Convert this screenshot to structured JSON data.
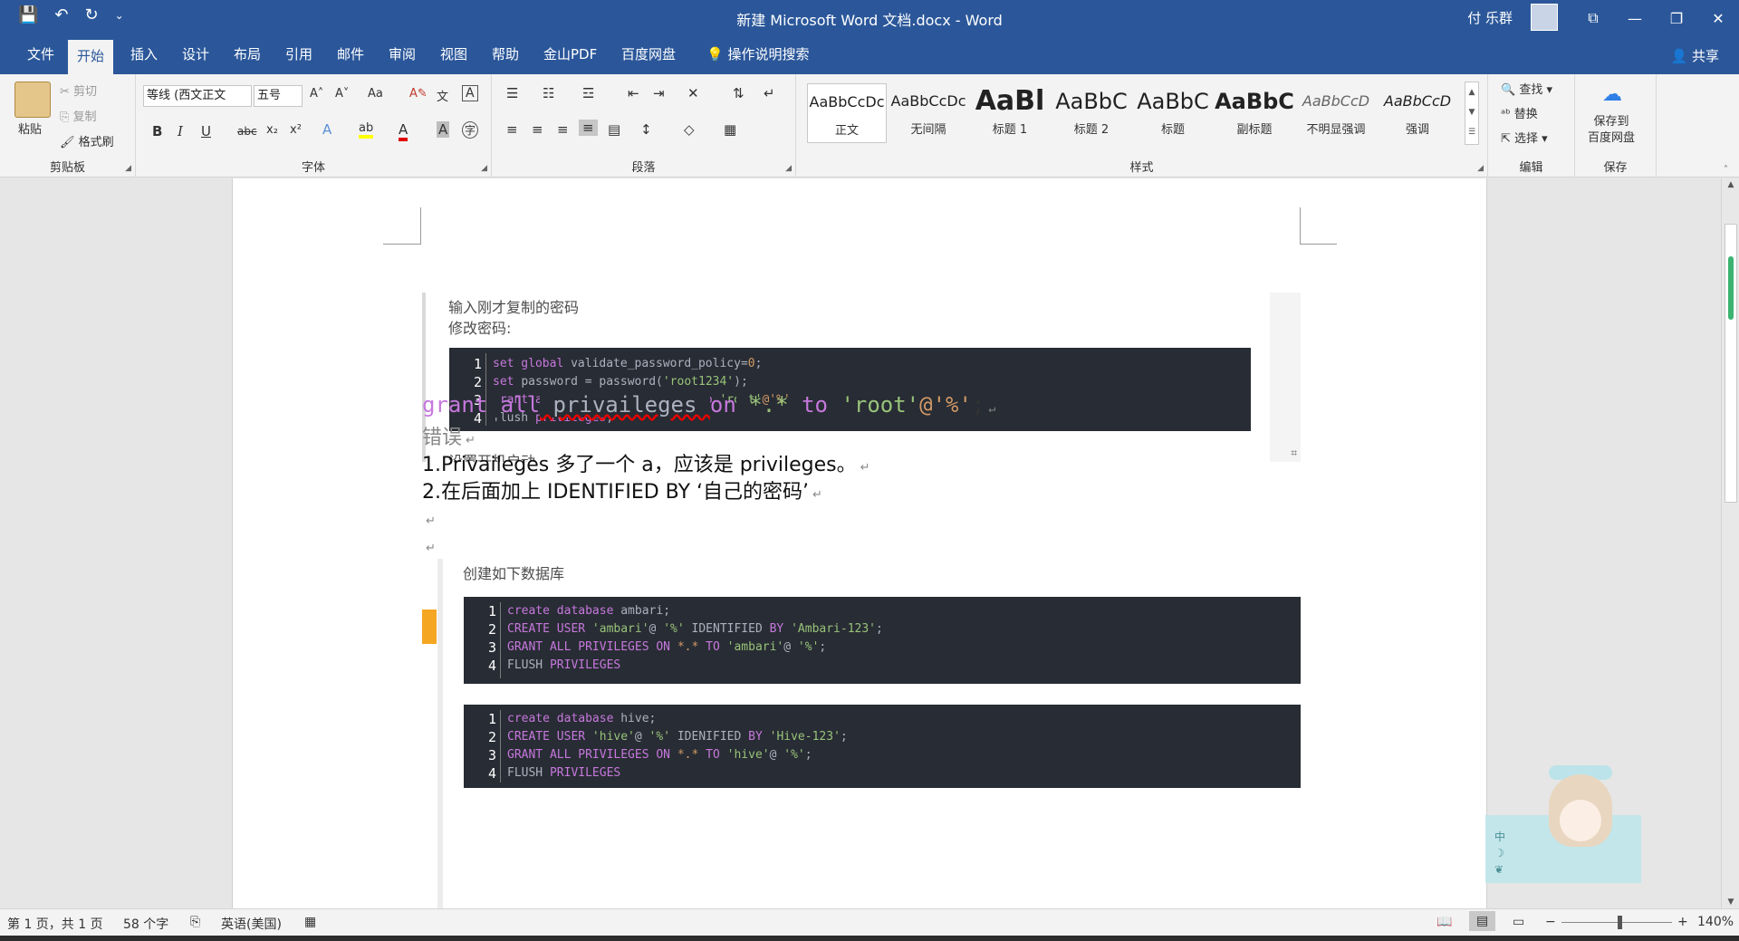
{
  "window": {
    "title": "新建 Microsoft Word 文档.docx  -  Word",
    "user": "付 乐群",
    "qat": {
      "save": "💾",
      "undo": "↶",
      "redo": "↻",
      "customize": "⌄"
    },
    "buttons": {
      "ribbon_display": "⧉",
      "minimize": "—",
      "restore": "❐",
      "close": "✕"
    }
  },
  "tabs": [
    "文件",
    "开始",
    "插入",
    "设计",
    "布局",
    "引用",
    "邮件",
    "审阅",
    "视图",
    "帮助",
    "金山PDF",
    "百度网盘"
  ],
  "tell_me": "操作说明搜索",
  "share": "共享",
  "ribbon": {
    "clipboard": {
      "label": "剪贴板",
      "paste": "粘贴",
      "cut": "剪切",
      "copy": "复制",
      "format_painter": "格式刷"
    },
    "font": {
      "label": "字体",
      "font_name": "等线 (西文正文",
      "font_size": "五号",
      "grow": "A˄",
      "shrink": "A˅",
      "case": "Aa",
      "clear": "A✎",
      "phonetic": "文",
      "border": "A",
      "bold": "B",
      "italic": "I",
      "underline": "U",
      "strike": "abc",
      "subscript": "x₂",
      "superscript": "x²",
      "effects": "A",
      "highlight": "ab",
      "color": "A",
      "shading": "A",
      "enclose": "字"
    },
    "paragraph": {
      "label": "段落"
    },
    "styles": {
      "label": "样式",
      "items": [
        {
          "sample": "AaBbCcDc",
          "name": "正文"
        },
        {
          "sample": "AaBbCcDc",
          "name": "无间隔"
        },
        {
          "sample": "AaBl",
          "name": "标题 1"
        },
        {
          "sample": "AaBbC",
          "name": "标题 2"
        },
        {
          "sample": "AaBbC",
          "name": "标题"
        },
        {
          "sample": "AaBbC",
          "name": "副标题"
        },
        {
          "sample": "AaBbCcD",
          "name": "不明显强调"
        },
        {
          "sample": "AaBbCcD",
          "name": "强调"
        }
      ]
    },
    "editing": {
      "label": "编辑",
      "find": "查找",
      "replace": "替换",
      "select": "选择"
    },
    "save": {
      "label": "保存",
      "button": "保存到\n百度网盘"
    }
  },
  "document": {
    "pasted1": {
      "line1": "输入刚才复制的密码",
      "line2": "修改密码:",
      "line3": "设置开机启动",
      "code": [
        [
          [
            "kw",
            "set global "
          ],
          [
            "t",
            "validate_password_policy"
          ],
          [
            "t",
            "="
          ],
          [
            "num",
            "0"
          ],
          [
            "t",
            ";"
          ]
        ],
        [
          [
            "kw",
            "set "
          ],
          [
            "t",
            "password = password("
          ],
          [
            "str",
            "'root1234'"
          ],
          [
            "t",
            ");"
          ]
        ],
        [
          [
            "kw",
            "grant all "
          ],
          [
            "t",
            "privaileges "
          ],
          [
            "kw",
            "on "
          ],
          [
            "num",
            "*.* "
          ],
          [
            "kw",
            "to "
          ],
          [
            "str",
            "'root'"
          ],
          [
            "num",
            "@'%'"
          ],
          [
            "t",
            ";"
          ]
        ],
        [
          [
            "t",
            "flush "
          ],
          [
            "kw",
            "privileges"
          ],
          [
            "t",
            ";"
          ]
        ]
      ]
    },
    "grant_line": {
      "grant": "grant",
      "all": "all",
      "privaileges": " privaileges ",
      "on": "on",
      "wild": "*.*",
      "to": "to",
      "root": "'root'",
      "at": "@'%'",
      "semi": ";"
    },
    "error_heading": "错误",
    "error_1": "1.Privaileges 多了一个 a，应该是 privileges。",
    "error_2": "2.在后面加上 IDENTIFIED BY ‘自己的密码’",
    "pasted2": {
      "heading": "创建如下数据库",
      "code1": [
        [
          [
            "kw",
            "create database "
          ],
          [
            "t",
            "ambari;"
          ]
        ],
        [
          [
            "kw",
            "CREATE USER "
          ],
          [
            "str",
            "'ambari'"
          ],
          [
            "t",
            "@ "
          ],
          [
            "str",
            "'%' "
          ],
          [
            "t",
            "IDENTIFIED "
          ],
          [
            "kw",
            "BY "
          ],
          [
            "str",
            "'Ambari-123'"
          ],
          [
            "t",
            ";"
          ]
        ],
        [
          [
            "kw",
            "GRANT ALL PRIVILEGES ON "
          ],
          [
            "num",
            "*.* "
          ],
          [
            "kw",
            "TO "
          ],
          [
            "str",
            "'ambari'"
          ],
          [
            "t",
            "@ "
          ],
          [
            "str",
            "'%'"
          ],
          [
            "t",
            ";"
          ]
        ],
        [
          [
            "t",
            "FLUSH "
          ],
          [
            "kw",
            "PRIVILEGES"
          ]
        ]
      ],
      "code2": [
        [
          [
            "kw",
            "create database "
          ],
          [
            "t",
            "hive;"
          ]
        ],
        [
          [
            "kw",
            "CREATE USER "
          ],
          [
            "str",
            "'hive'"
          ],
          [
            "t",
            "@ "
          ],
          [
            "str",
            "'%' "
          ],
          [
            "t",
            "IDENIFIED "
          ],
          [
            "kw",
            "BY "
          ],
          [
            "str",
            "'Hive-123'"
          ],
          [
            "t",
            ";"
          ]
        ],
        [
          [
            "kw",
            "GRANT ALL PRIVILEGES ON "
          ],
          [
            "num",
            "*.* "
          ],
          [
            "kw",
            "TO "
          ],
          [
            "str",
            "'hive'"
          ],
          [
            "t",
            "@ "
          ],
          [
            "str",
            "'%'"
          ],
          [
            "t",
            ";"
          ]
        ],
        [
          [
            "t",
            "FLUSH "
          ],
          [
            "kw",
            "PRIVILEGES"
          ]
        ]
      ]
    }
  },
  "status": {
    "page": "第 1 页，共 1 页",
    "words": "58 个字",
    "language": "英语(美国)",
    "zoom": "140%"
  },
  "mascot_text": "中 ☽ ❦"
}
